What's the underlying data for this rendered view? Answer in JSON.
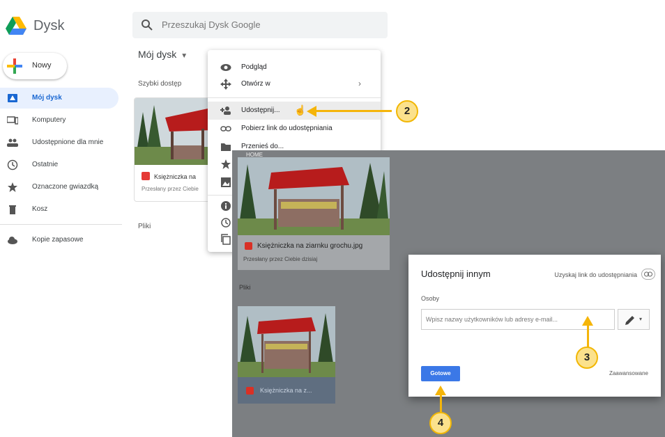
{
  "drive": {
    "brand": "Dysk",
    "search_placeholder": "Przeszukaj Dysk Google",
    "new_button": "Nowy",
    "nav": [
      {
        "label": "Mój dysk",
        "icon": "my-drive-icon",
        "active": true
      },
      {
        "label": "Komputery",
        "icon": "computers-icon"
      },
      {
        "label": "Udostępnione dla mnie",
        "icon": "shared-icon"
      },
      {
        "label": "Ostatnie",
        "icon": "clock-icon"
      },
      {
        "label": "Oznaczone gwiazdką",
        "icon": "star-icon"
      },
      {
        "label": "Kosz",
        "icon": "trash-icon"
      },
      {
        "label": "Kopie zapasowe",
        "icon": "cloud-icon"
      }
    ],
    "main_title": "Mój dysk",
    "quick_access": "Szybki dostęp",
    "files_section": "Pliki",
    "quick_card": {
      "name": "Księżniczka na",
      "sub": "Przesłany przez Ciebie"
    },
    "context_menu": [
      {
        "label": "Podgląd",
        "icon": "eye-icon"
      },
      {
        "label": "Otwórz w",
        "icon": "move-icon",
        "arrow": "›"
      },
      {
        "label": "Udostępnij...",
        "icon": "add-person-icon",
        "highlight": true
      },
      {
        "label": "Pobierz link do udostępniania",
        "icon": "link-icon"
      },
      {
        "label": "Przenieś do...",
        "icon": "folder-icon"
      }
    ]
  },
  "share": {
    "home_label": "HOME",
    "card": {
      "name": "Księżniczka na ziarnku grochu.jpg",
      "sub": "Przesłany przez Ciebie dzisiaj"
    },
    "files_section": "Pliki",
    "small_card": {
      "name": "Księżniczka na z..."
    },
    "dialog": {
      "title": "Udostępnij innym",
      "get_link": "Uzyskaj link do udostępniania",
      "people_label": "Osoby",
      "input_placeholder": "Wpisz nazwy użytkowników lub adresy e-mail...",
      "done_button": "Gotowe",
      "advanced": "Zaawansowane"
    }
  },
  "callouts": [
    "2",
    "3",
    "4"
  ],
  "colors": {
    "accent": "#3b78e7",
    "callout": "#fbe18c",
    "callout_border": "#f2b705",
    "overlay": "#7c7f82"
  }
}
